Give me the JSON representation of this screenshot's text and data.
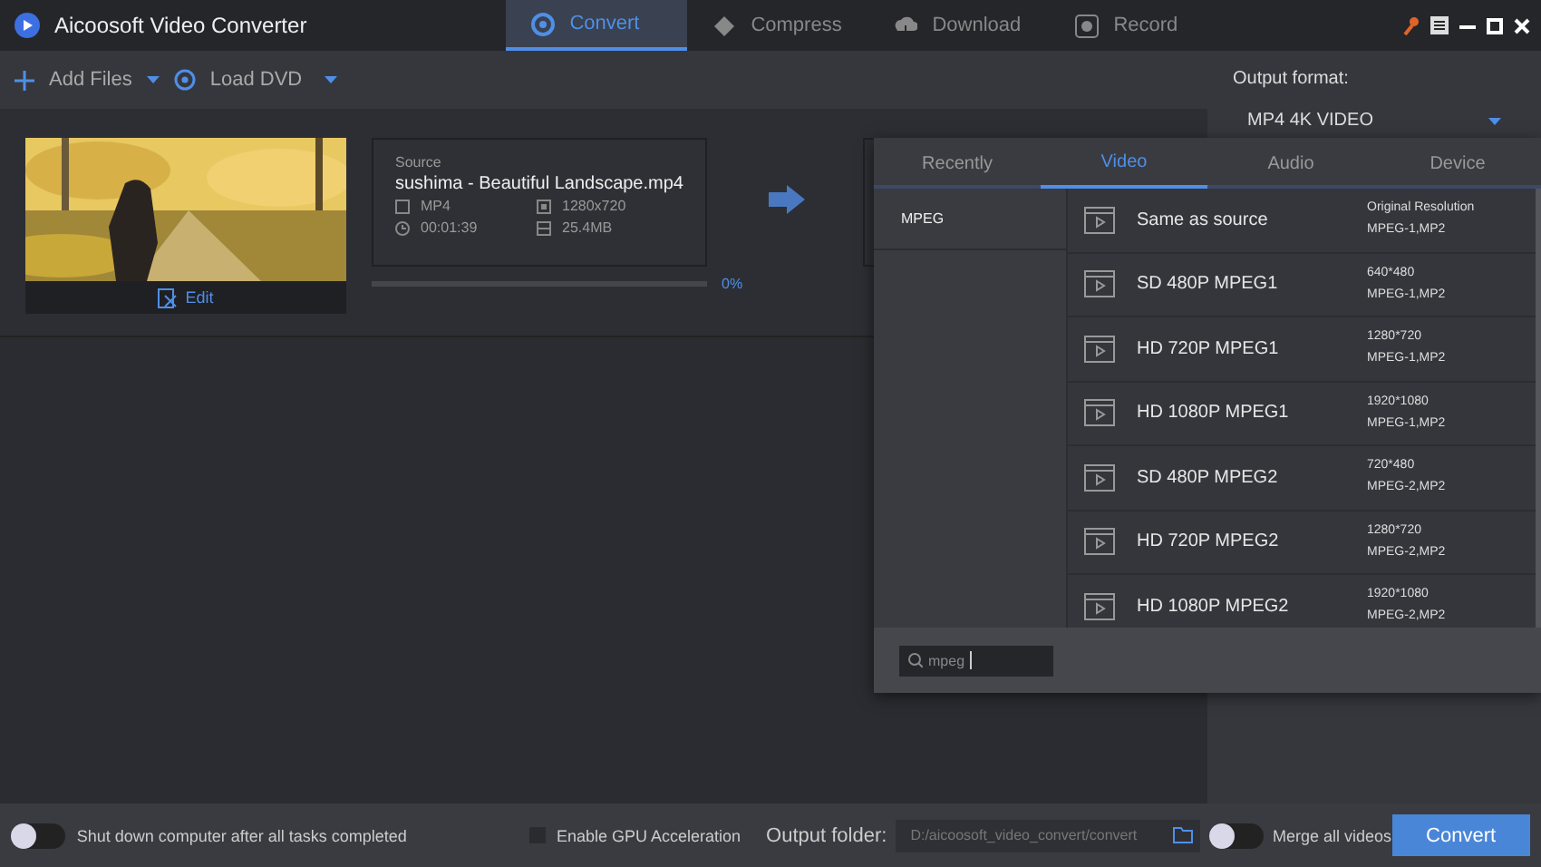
{
  "window": {
    "title": "Aicoosoft Video Converter"
  },
  "nav_tabs": [
    {
      "label": "Convert",
      "selected": true,
      "kind": "convert"
    },
    {
      "label": "Compress",
      "selected": false,
      "kind": "compress"
    },
    {
      "label": "Download",
      "selected": false,
      "kind": "download"
    },
    {
      "label": "Record",
      "selected": false,
      "kind": "record"
    }
  ],
  "toolbar": {
    "add_files": "Add Files",
    "load_dvd": "Load DVD"
  },
  "file": {
    "edit": "Edit",
    "source_label": "Source",
    "name": "sushima - Beautiful Landscape.mp4",
    "format": "MP4",
    "resolution": "1280x720",
    "duration": "00:01:39",
    "size": "25.4MB",
    "progress": "0%",
    "level": 0
  },
  "output_format": {
    "label": "Output format:",
    "value": "MP4 4K VIDEO"
  },
  "format_popup": {
    "tabs": [
      {
        "label": "Recently",
        "selected": false
      },
      {
        "label": "Video",
        "selected": true
      },
      {
        "label": "Audio",
        "selected": false
      },
      {
        "label": "Device",
        "selected": false
      }
    ],
    "categories": [
      {
        "label": "MPEG",
        "selected": true
      }
    ],
    "presets": [
      {
        "name": "Same as source",
        "line1": "Original Resolution",
        "line2": "MPEG-1,MP2"
      },
      {
        "name": "SD 480P MPEG1",
        "line1": "640*480",
        "line2": "MPEG-1,MP2"
      },
      {
        "name": "HD 720P MPEG1",
        "line1": "1280*720",
        "line2": "MPEG-1,MP2"
      },
      {
        "name": "HD 1080P MPEG1",
        "line1": "1920*1080",
        "line2": "MPEG-1,MP2"
      },
      {
        "name": "SD 480P MPEG2",
        "line1": "720*480",
        "line2": "MPEG-2,MP2"
      },
      {
        "name": "HD 720P MPEG2",
        "line1": "1280*720",
        "line2": "MPEG-2,MP2"
      },
      {
        "name": "HD 1080P MPEG2",
        "line1": "1920*1080",
        "line2": "MPEG-2,MP2"
      }
    ],
    "search": {
      "value": "mpeg"
    }
  },
  "bottom_bar": {
    "shutdown": {
      "label": "Shut down computer after all tasks completed",
      "on": false
    },
    "gpu": {
      "label": "Enable GPU Acceleration",
      "checked": false
    },
    "output_folder_label": "Output folder:",
    "output_folder": "D:/aicoosoft_video_convert/convert",
    "merge": {
      "label": "Merge all videos",
      "on": false
    },
    "convert": "Convert"
  }
}
